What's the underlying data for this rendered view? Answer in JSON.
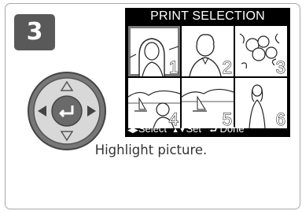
{
  "step": {
    "number": "3"
  },
  "lcd": {
    "title": "PRINT SELECTION",
    "thumbnails": [
      {
        "number": "1",
        "selected": true
      },
      {
        "number": "2",
        "selected": false
      },
      {
        "number": "3",
        "selected": false
      },
      {
        "number": "4",
        "selected": false
      },
      {
        "number": "5",
        "selected": false
      },
      {
        "number": "6",
        "selected": false
      }
    ],
    "footer": {
      "select_label": "Select",
      "set_label": "Set",
      "done_label": "Done"
    }
  },
  "caption": "Highlight picture.",
  "colors": {
    "badge": "#595959",
    "lcd_background": "#000000",
    "selection_outline": "#7a7a7a",
    "caption_text": "#333333"
  }
}
